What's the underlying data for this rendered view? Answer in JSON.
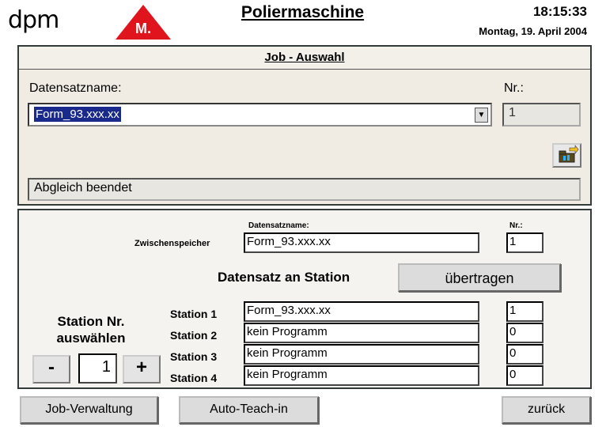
{
  "header": {
    "logo_text": "dpm",
    "badge_text": "M.",
    "title": "Poliermaschine",
    "time": "18:15:33",
    "date": "Montag, 19. April 2004"
  },
  "job_panel": {
    "title": "Job - Auswahl",
    "datensatz_label": "Datensatzname:",
    "datensatz_value": "Form_93.xxx.xx",
    "nr_label": "Nr.:",
    "nr_value": "1",
    "status": "Abgleich beendet",
    "action_icon": "folder-transfer-icon"
  },
  "transfer_panel": {
    "datensatz_label": "Datensatzname:",
    "nr_label": "Nr.:",
    "zwischenspeicher_label": "Zwischenspeicher",
    "zwischenspeicher_name": "Form_93.xxx.xx",
    "zwischenspeicher_nr": "1",
    "heading": "Datensatz an Station",
    "transfer_button": "übertragen",
    "station_select_label_1": "Station Nr.",
    "station_select_label_2": "auswählen",
    "minus": "-",
    "plus": "+",
    "station_value": "1",
    "stations": [
      {
        "label": "Station 1",
        "name": "Form_93.xxx.xx",
        "nr": "1"
      },
      {
        "label": "Station 2",
        "name": "kein Programm",
        "nr": "0"
      },
      {
        "label": "Station 3",
        "name": "kein Programm",
        "nr": "0"
      },
      {
        "label": "Station 4",
        "name": "kein Programm",
        "nr": "0"
      }
    ]
  },
  "footer": {
    "job_verwaltung": "Job-Verwaltung",
    "auto_teach": "Auto-Teach-in",
    "zurueck": "zurück"
  },
  "colors": {
    "badge_red": "#e0141c",
    "selection_blue": "#1a2a8c"
  }
}
